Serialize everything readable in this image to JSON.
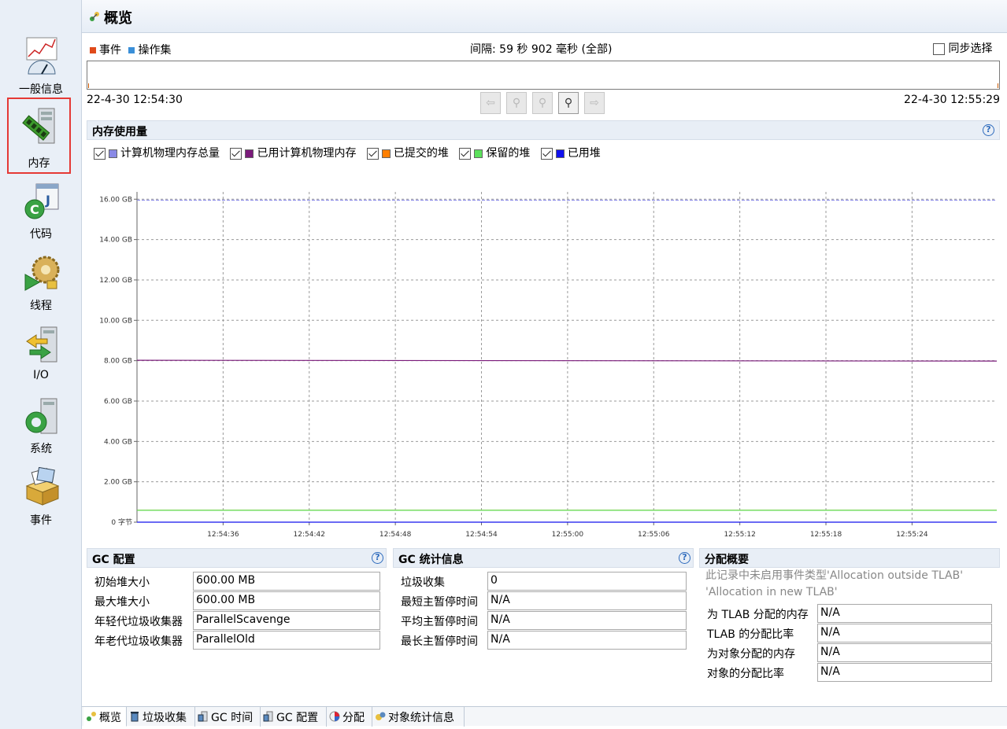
{
  "sidebar": {
    "items": [
      {
        "label": "一般信息",
        "icon": "gauge-chart-icon"
      },
      {
        "label": "内存",
        "icon": "memory-module-icon",
        "active": true
      },
      {
        "label": "代码",
        "icon": "java-code-icon"
      },
      {
        "label": "线程",
        "icon": "thread-gears-icon"
      },
      {
        "label": "I/O",
        "icon": "io-transfer-icon"
      },
      {
        "label": "系统",
        "icon": "system-server-icon"
      },
      {
        "label": "事件",
        "icon": "event-box-icon"
      }
    ]
  },
  "header": {
    "title": "概览"
  },
  "timeline": {
    "legend": [
      {
        "label": "事件",
        "color": "#e04a1a"
      },
      {
        "label": "操作集",
        "color": "#3a8fd8"
      }
    ],
    "interval": "间隔: 59 秒 902 毫秒 (全部)",
    "sync_label": "同步选择",
    "start_time": "22-4-30 12:54:30",
    "end_time": "22-4-30 12:55:29"
  },
  "memory": {
    "title": "内存使用量",
    "help": "?"
  },
  "chart_data": {
    "type": "line",
    "title": "",
    "xlabel": "",
    "ylabel": "",
    "x": [
      "12:54:30",
      "12:55:29"
    ],
    "x_ticks": [
      "12:54:36",
      "12:54:42",
      "12:54:48",
      "12:54:54",
      "12:55:00",
      "12:55:06",
      "12:55:12",
      "12:55:18",
      "12:55:24"
    ],
    "y_ticks": [
      "0 字节",
      "2.00 GB",
      "4.00 GB",
      "6.00 GB",
      "8.00 GB",
      "10.00 GB",
      "12.00 GB",
      "14.00 GB",
      "16.00 GB"
    ],
    "ylim": [
      0,
      16
    ],
    "grid": true,
    "series": [
      {
        "name": "计算机物理内存总量",
        "color": "#8a8ae6",
        "checked": true,
        "values": [
          15.95,
          15.95
        ]
      },
      {
        "name": "已用计算机物理内存",
        "color": "#7a1a7a",
        "checked": true,
        "values": [
          8.02,
          7.98
        ]
      },
      {
        "name": "已提交的堆",
        "color": "#ff7f00",
        "checked": true,
        "values": [
          0.59,
          0.59
        ]
      },
      {
        "name": "保留的堆",
        "color": "#5be05b",
        "checked": true,
        "values": [
          0.59,
          0.59
        ]
      },
      {
        "name": "已用堆",
        "color": "#1010ee",
        "checked": true,
        "values": [
          0.0,
          0.0
        ]
      }
    ]
  },
  "gc_config": {
    "title": "GC 配置",
    "rows": [
      {
        "label": "初始堆大小",
        "value": "600.00 MB"
      },
      {
        "label": "最大堆大小",
        "value": "600.00 MB"
      },
      {
        "label": "年轻代垃圾收集器",
        "value": "ParallelScavenge"
      },
      {
        "label": "年老代垃圾收集器",
        "value": "ParallelOld"
      }
    ]
  },
  "gc_stats": {
    "title": "GC 统计信息",
    "rows": [
      {
        "label": "垃圾收集",
        "value": "0"
      },
      {
        "label": "最短主暂停时间",
        "value": "N/A"
      },
      {
        "label": "平均主暂停时间",
        "value": "N/A"
      },
      {
        "label": "最长主暂停时间",
        "value": "N/A"
      }
    ]
  },
  "alloc": {
    "title": "分配概要",
    "note_line1": "此记录中未启用事件类型'Allocation outside TLAB'",
    "note_line2": "'Allocation in new TLAB'",
    "rows": [
      {
        "label": "为 TLAB 分配的内存",
        "value": "N/A"
      },
      {
        "label": "TLAB 的分配比率",
        "value": "N/A"
      },
      {
        "label": "为对象分配的内存",
        "value": "N/A"
      },
      {
        "label": "对象的分配比率",
        "value": "N/A"
      }
    ]
  },
  "bottom_tabs": [
    {
      "label": "概览",
      "icon": "overview-icon",
      "active": true
    },
    {
      "label": "垃圾收集",
      "icon": "trash-icon"
    },
    {
      "label": "GC 时间",
      "icon": "gc-time-icon"
    },
    {
      "label": "GC 配置",
      "icon": "gc-config-icon"
    },
    {
      "label": "分配",
      "icon": "allocation-pie-icon"
    },
    {
      "label": "对象统计信息",
      "icon": "object-stats-icon"
    }
  ]
}
